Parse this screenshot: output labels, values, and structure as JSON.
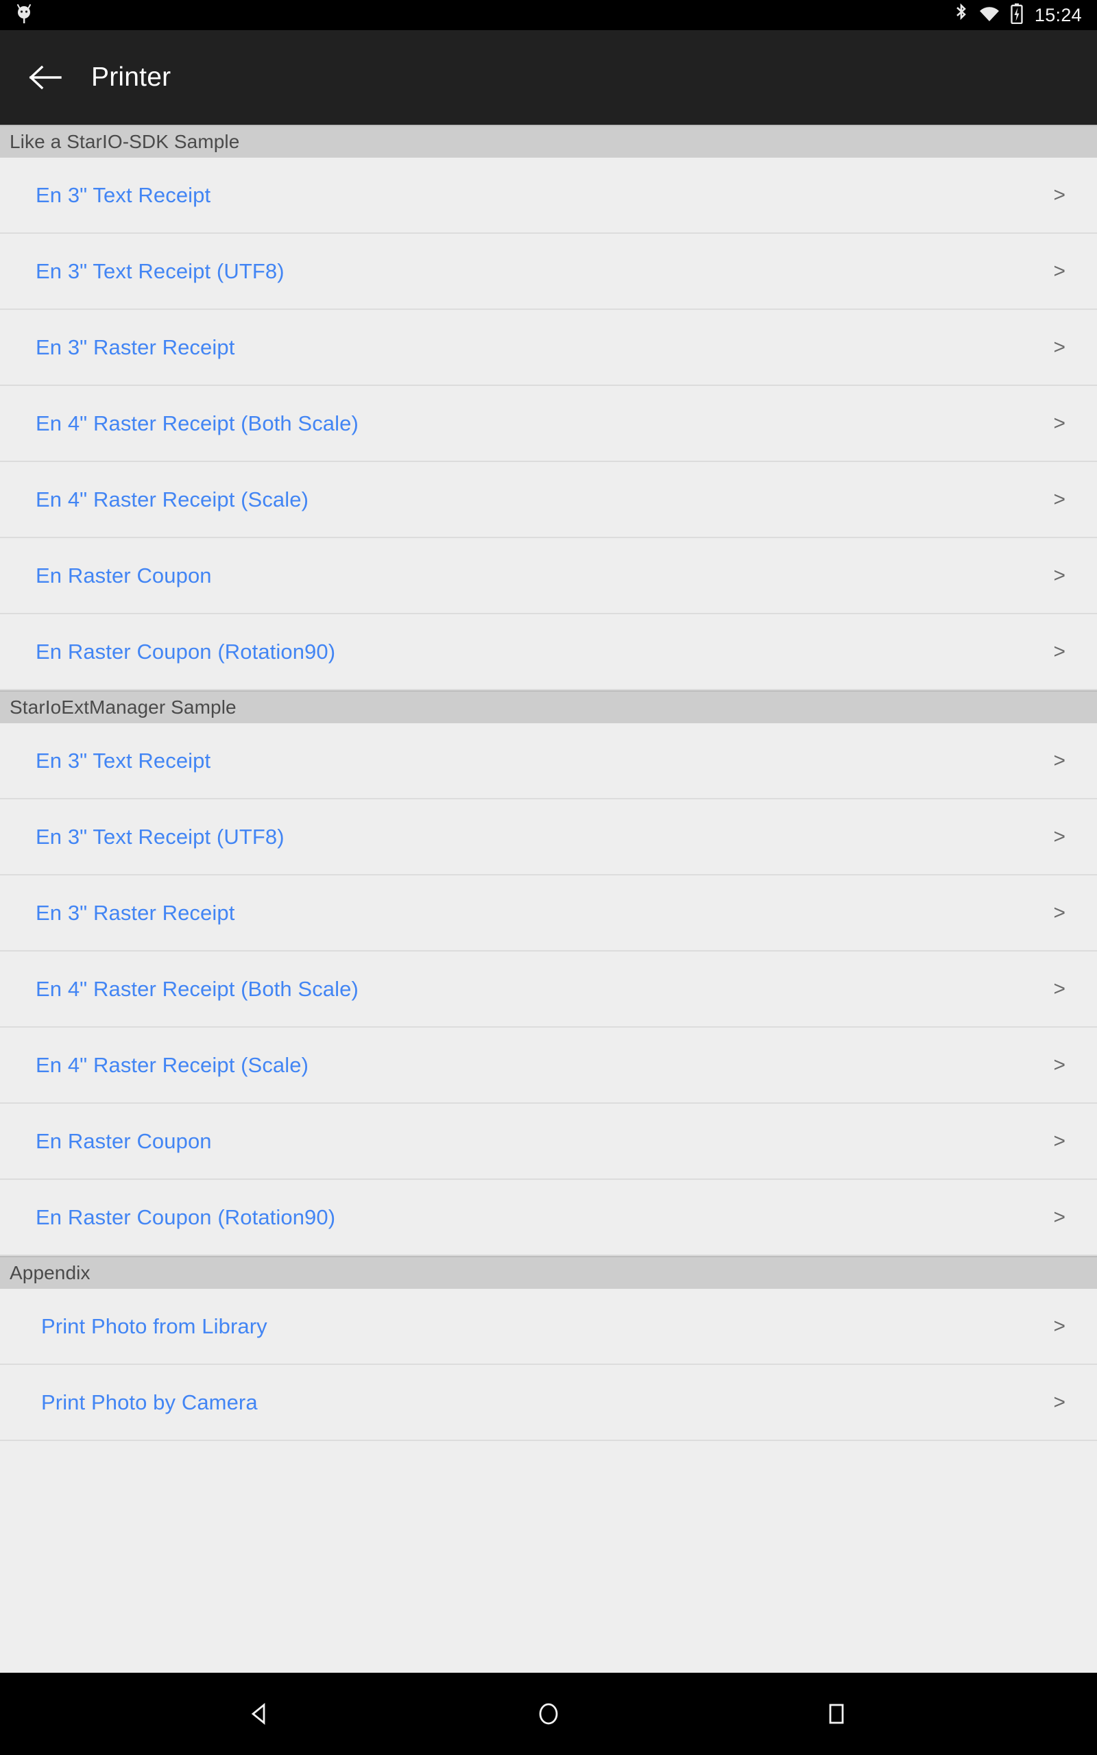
{
  "status_bar": {
    "notification_icon": "android-robot-icon",
    "icons": [
      "bluetooth-icon",
      "wifi-icon",
      "battery-charging-icon"
    ],
    "clock": "15:24"
  },
  "app_bar": {
    "back_icon": "back-arrow-icon",
    "title": "Printer"
  },
  "colors": {
    "accent_link": "#4285f4",
    "app_bar_bg": "#212121",
    "section_header_bg": "#cdcdcd",
    "list_bg": "#eeeeee",
    "divider": "#dcdcdc",
    "section_header_text": "#4a4a4a",
    "chevron": "#6b6b6b"
  },
  "chevron_glyph": ">",
  "sections": [
    {
      "header": "Like a StarIO-SDK Sample",
      "indent": false,
      "items": [
        "En 3\" Text Receipt",
        "En 3\" Text Receipt (UTF8)",
        "En 3\" Raster Receipt",
        "En 4\" Raster Receipt (Both Scale)",
        "En 4\" Raster Receipt (Scale)",
        "En Raster Coupon",
        "En Raster Coupon (Rotation90)"
      ]
    },
    {
      "header": "StarIoExtManager Sample",
      "indent": false,
      "items": [
        "En 3\" Text Receipt",
        "En 3\" Text Receipt (UTF8)",
        "En 3\" Raster Receipt",
        "En 4\" Raster Receipt (Both Scale)",
        "En 4\" Raster Receipt (Scale)",
        "En Raster Coupon",
        "En Raster Coupon (Rotation90)"
      ]
    },
    {
      "header": "Appendix",
      "indent": true,
      "items": [
        "Print Photo from Library",
        "Print Photo by Camera"
      ]
    }
  ],
  "nav_bar": {
    "back": "nav-back-icon",
    "home": "nav-home-icon",
    "recents": "nav-recents-icon"
  }
}
